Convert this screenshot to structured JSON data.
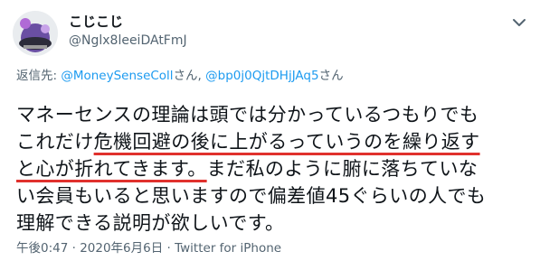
{
  "author": {
    "display_name": "こじこじ",
    "handle": "@Nglx8leeiDAtFmJ"
  },
  "reply": {
    "prefix": "返信先: ",
    "mention_1": "@MoneySenseColl",
    "mention_1_suffix": "さん, ",
    "mention_2": "@bp0j0QjtDHjJAq5",
    "mention_2_suffix": "さん"
  },
  "tweet": {
    "line1": "マネーセンスの理論は頭では分かっているつもりでも",
    "line2_a": "これだけ",
    "line2_b": "危機回避の後に上がるっていうのを繰り返す",
    "line3_a": "と心が折れてきます。",
    "line3_b": "まだ私のように腑に落ちていな",
    "line4": "い会員もいると思いますので偏差値45ぐらいの人でも",
    "line5": "理解できる説明が欲しいです。"
  },
  "meta": {
    "time": "午後0:47",
    "sep1": " · ",
    "date": "2020年6月6日",
    "sep2": " · ",
    "client": "Twitter for iPhone"
  },
  "colors": {
    "link": "#1d9bf0",
    "underline": "#e0312d",
    "secondary_text": "#536471"
  },
  "icons": {
    "more": "chevron-down-icon"
  }
}
